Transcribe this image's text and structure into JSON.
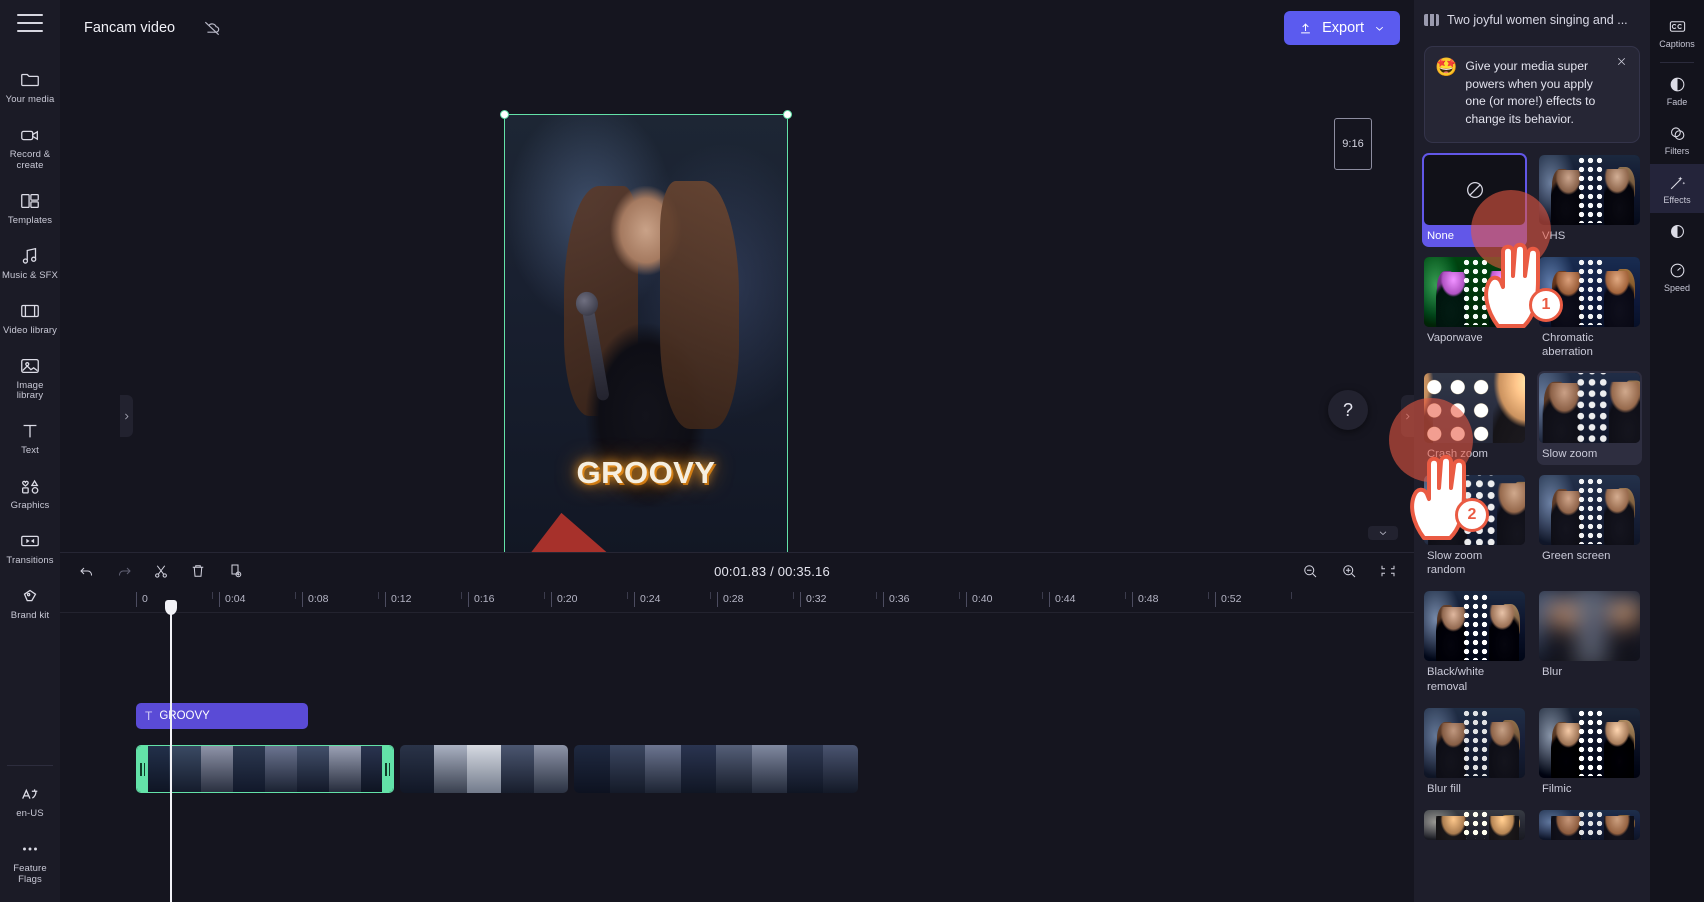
{
  "app": {
    "project_title": "Fancam video",
    "cloud_status_icon": "cloud-off-icon",
    "export_label": "Export"
  },
  "left_sidebar": {
    "menu_icon": "hamburger-menu-icon",
    "items": [
      {
        "label": "Your media",
        "icon": "folder-icon"
      },
      {
        "label": "Record & create",
        "icon": "video-camera-icon"
      },
      {
        "label": "Templates",
        "icon": "templates-icon"
      },
      {
        "label": "Music & SFX",
        "icon": "music-note-icon"
      },
      {
        "label": "Video library",
        "icon": "film-strip-icon"
      },
      {
        "label": "Image library",
        "icon": "image-icon"
      },
      {
        "label": "Text",
        "icon": "text-t-icon"
      },
      {
        "label": "Graphics",
        "icon": "graphics-shapes-icon"
      },
      {
        "label": "Transitions",
        "icon": "transitions-icon"
      },
      {
        "label": "Brand kit",
        "icon": "brand-kit-icon"
      }
    ],
    "bottom_items": [
      {
        "label": "en-US",
        "icon": "language-icon"
      },
      {
        "label": "Feature Flags",
        "icon": "ellipsis-icon"
      }
    ]
  },
  "preview": {
    "aspect_ratio_badge": "9:16",
    "caption_text": "GROOVY",
    "float_tools": [
      {
        "icon": "fit-to-screen-icon"
      },
      {
        "icon": "crop-icon"
      },
      {
        "icon": "picture-in-picture-icon"
      },
      {
        "icon": "rotate-icon"
      },
      {
        "icon": "flip-horizontal-icon"
      },
      {
        "icon": "flip-vertical-icon"
      }
    ],
    "transport": [
      {
        "icon": "skip-to-start-icon"
      },
      {
        "icon": "rewind-5s-icon"
      },
      {
        "icon": "play-icon"
      },
      {
        "icon": "forward-5s-icon"
      },
      {
        "icon": "skip-to-end-icon"
      },
      {
        "icon": "fullscreen-icon"
      }
    ],
    "help_icon": "question-mark-icon"
  },
  "timeline": {
    "tools": [
      {
        "icon": "undo-icon",
        "dim": false
      },
      {
        "icon": "redo-icon",
        "dim": true
      },
      {
        "icon": "scissors-split-icon",
        "dim": false
      },
      {
        "icon": "trash-delete-icon",
        "dim": false
      },
      {
        "icon": "duplicate-icon",
        "dim": false
      }
    ],
    "current_time": "00:01.83",
    "total_time": "00:35.16",
    "time_separator": "/",
    "zoom_tools": [
      {
        "icon": "zoom-out-icon"
      },
      {
        "icon": "zoom-in-icon"
      },
      {
        "icon": "fit-timeline-icon"
      }
    ],
    "ruler_ticks": [
      "0",
      "0:04",
      "0:08",
      "0:12",
      "0:16",
      "0:20",
      "0:24",
      "0:28",
      "0:32",
      "0:36",
      "0:40",
      "0:44",
      "0:48",
      "0:52"
    ],
    "text_clip": {
      "label": "GROOVY",
      "icon": "text-t-icon"
    },
    "video_clips": [
      {
        "name": "video-clip-1",
        "selected": true
      },
      {
        "name": "video-clip-2",
        "selected": false
      },
      {
        "name": "video-clip-3",
        "selected": false
      }
    ]
  },
  "properties_panel": {
    "header_title": "Two joyful women singing and ...",
    "header_icon": "film-strip-icon",
    "tip": {
      "emoji": "🤩",
      "text": "Give your media super powers when you apply one (or more!) effects to change its behavior.",
      "close_icon": "close-icon"
    },
    "effects": [
      {
        "label": "None",
        "state": "selected",
        "thumb": "none"
      },
      {
        "label": "VHS",
        "state": "normal",
        "thumb": "vhs"
      },
      {
        "label": "Vaporwave",
        "state": "normal",
        "thumb": "vapor"
      },
      {
        "label": "Chromatic aberration",
        "state": "normal",
        "thumb": "chroma"
      },
      {
        "label": "Crash zoom",
        "state": "normal",
        "thumb": "crash"
      },
      {
        "label": "Slow zoom",
        "state": "hover",
        "thumb": "slowzoom"
      },
      {
        "label": "Slow zoom random",
        "state": "normal",
        "thumb": "slowzoomr"
      },
      {
        "label": "Green screen",
        "state": "normal",
        "thumb": "green"
      },
      {
        "label": "Black/white removal",
        "state": "normal",
        "thumb": "bw"
      },
      {
        "label": "Blur",
        "state": "normal",
        "thumb": "blur"
      },
      {
        "label": "Blur fill",
        "state": "normal",
        "thumb": "blurfill"
      },
      {
        "label": "Filmic",
        "state": "normal",
        "thumb": "filmic"
      },
      {
        "label": "",
        "state": "normal",
        "thumb": "last1"
      },
      {
        "label": "",
        "state": "normal",
        "thumb": "last2"
      }
    ]
  },
  "far_rail": {
    "items": [
      {
        "label": "Captions",
        "icon": "closed-captions-icon",
        "active": false
      },
      {
        "label": "Fade",
        "icon": "fade-icon",
        "active": false
      },
      {
        "label": "Filters",
        "icon": "filters-icon",
        "active": false
      },
      {
        "label": "Effects",
        "icon": "effects-wand-icon",
        "active": true
      },
      {
        "label": "",
        "icon": "adjust-colors-icon",
        "active": false
      },
      {
        "label": "Speed",
        "icon": "speed-gauge-icon",
        "active": false
      }
    ]
  },
  "annotations": {
    "steps": [
      {
        "number": "1"
      },
      {
        "number": "2"
      }
    ],
    "accent_color": "#ea5b43"
  },
  "colors": {
    "accent_purple": "#5b5bef",
    "selection_green": "#63e2a8",
    "panel_bg": "#1e1e2b",
    "app_bg": "#15151f"
  }
}
